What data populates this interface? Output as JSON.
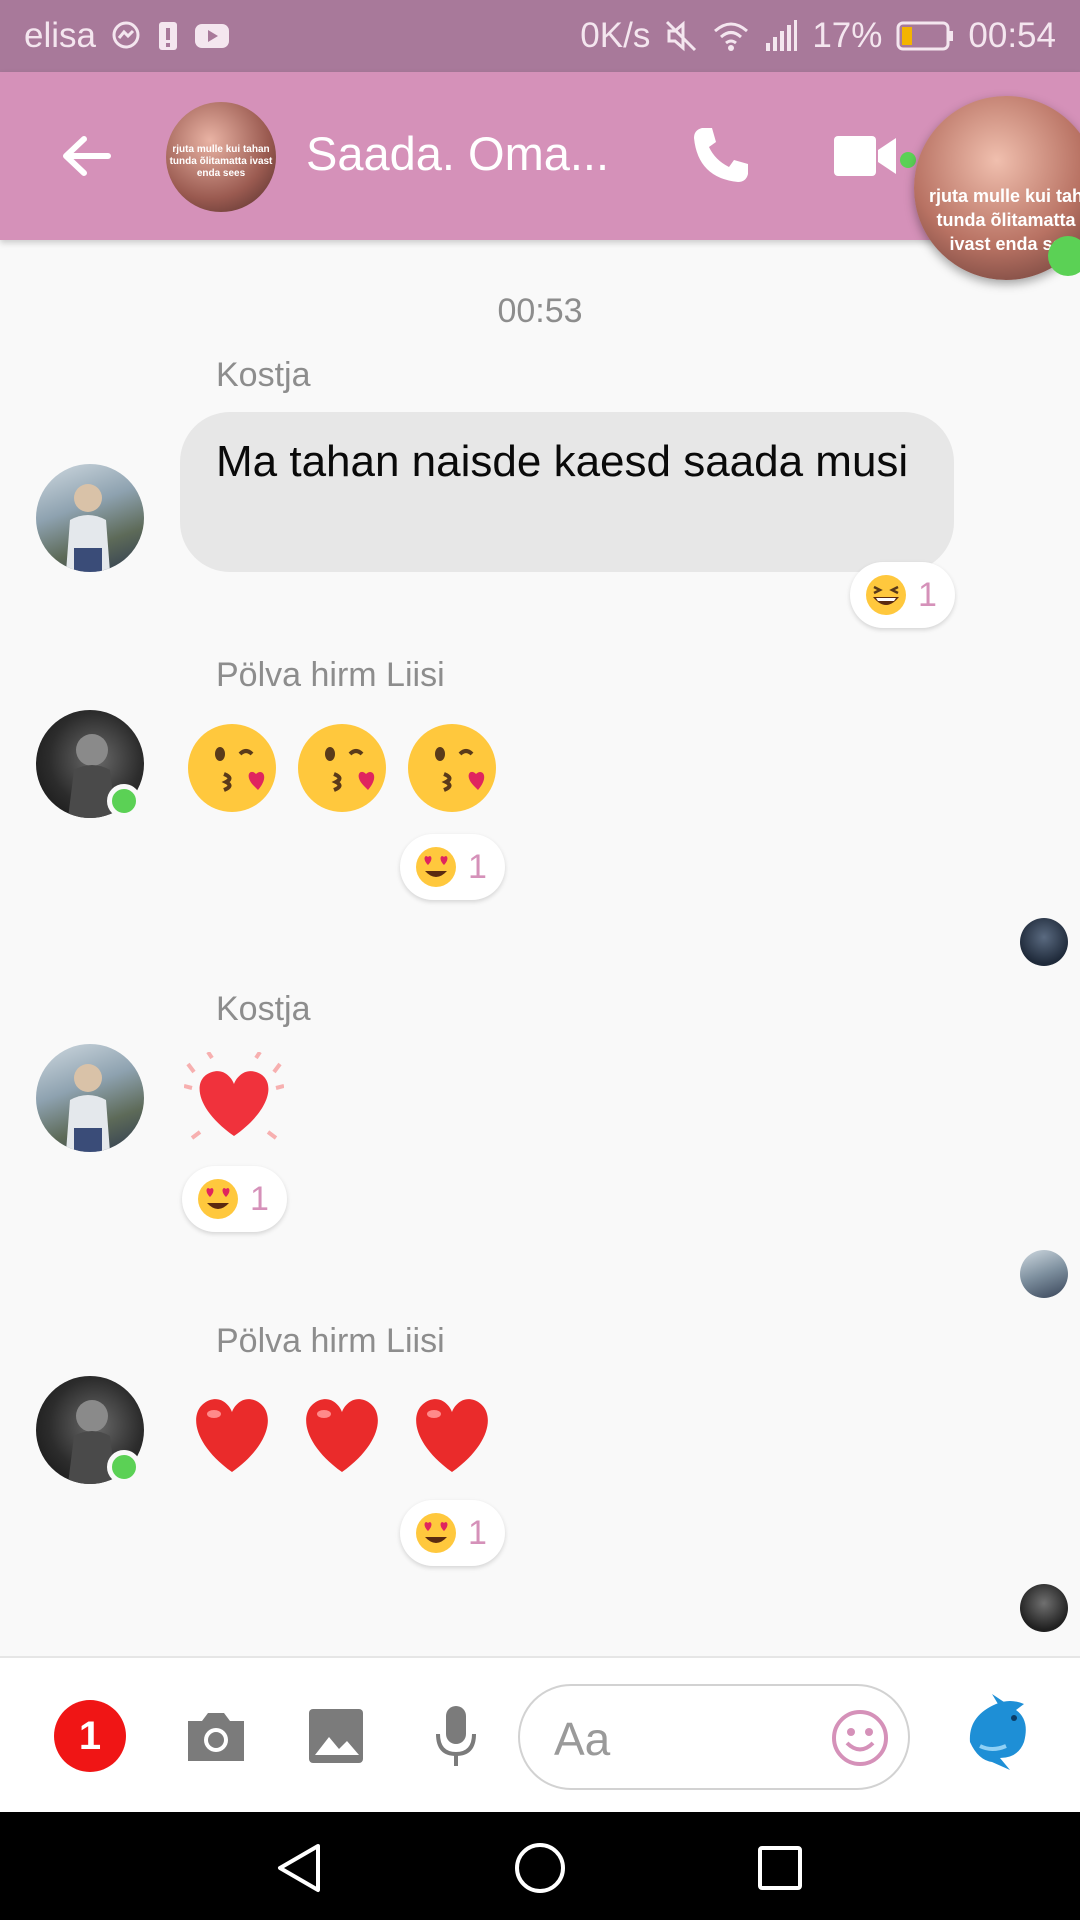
{
  "status_bar": {
    "carrier": "elisa",
    "speed": "0K/s",
    "battery": "17%",
    "time": "00:54",
    "icons": [
      "messenger-icon",
      "alert-icon",
      "youtube-icon",
      "mute-icon",
      "wifi-icon",
      "signal-icon",
      "battery-icon"
    ]
  },
  "header": {
    "title": "Saada. Oma...",
    "avatar_caption": "rjuta mulle kui tahan tunda õlitamatta ivast enda sees",
    "icons": [
      "back-arrow-icon",
      "phone-icon",
      "video-camera-icon"
    ]
  },
  "chat_head": {
    "caption": "rjuta mulle kui tah tunda õlitamatta ivast enda se"
  },
  "chat": {
    "timestamp": "00:53",
    "messages": [
      {
        "sender": "Kostja",
        "text": "Ma tahan naisde kaesd saada musi",
        "reaction": "grinning-squint-emoji",
        "reaction_count": "1"
      },
      {
        "sender": "Pölva hirm Liisi",
        "emojis": [
          "kissing-heart-emoji",
          "kissing-heart-emoji",
          "kissing-heart-emoji"
        ],
        "reaction": "heart-eyes-emoji",
        "reaction_count": "1"
      },
      {
        "sender": "Kostja",
        "emojis": [
          "beating-heart-emoji"
        ],
        "reaction": "heart-eyes-emoji",
        "reaction_count": "1"
      },
      {
        "sender": "Pölva hirm Liisi",
        "emojis": [
          "red-heart-emoji",
          "red-heart-emoji",
          "red-heart-emoji"
        ],
        "reaction": "heart-eyes-emoji",
        "reaction_count": "1"
      }
    ]
  },
  "composer": {
    "badge_count": "1",
    "placeholder": "Aa",
    "icons": [
      "camera-icon",
      "image-icon",
      "microphone-icon",
      "smiley-icon",
      "dolphin-icon"
    ]
  },
  "colors": {
    "status_bar": "#a8799a",
    "header": "#d591b9",
    "accent": "#d591b9",
    "online": "#5bd155",
    "badge": "#f01515"
  }
}
